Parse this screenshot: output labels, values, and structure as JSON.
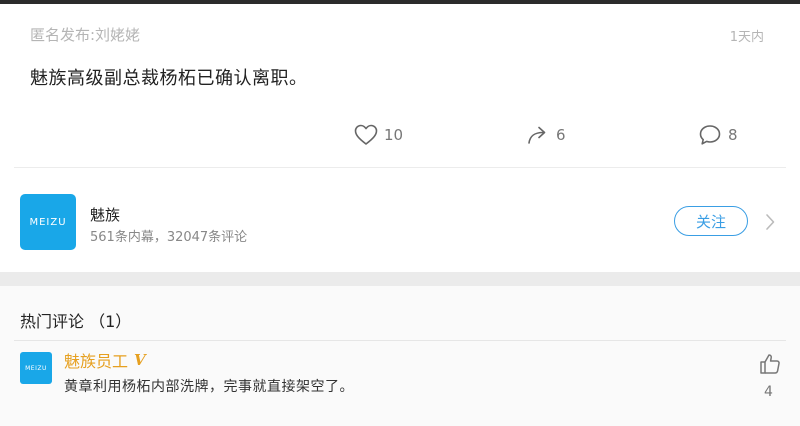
{
  "post": {
    "header": "匿名发布:刘姥姥",
    "time": "1天内",
    "text": "魅族高级副总裁杨柘已确认离职。",
    "likes": "10",
    "shares": "6",
    "comments": "8"
  },
  "account": {
    "logo_text": "MEIZU",
    "name": "魅族",
    "stats": "561条内幕，32047条评论",
    "follow_label": "关注"
  },
  "hot_comments": {
    "title": "热门评论 （1）",
    "items": [
      {
        "logo_text": "MEIZU",
        "author": "魅族员工",
        "badge": "V",
        "text": "黄章利用杨柘内部洗牌，完事就直接架空了。",
        "likes": "4"
      }
    ]
  },
  "colors": {
    "brand_blue": "#19a7e8",
    "follow_blue": "#3a9ee4",
    "author_gold": "#e6a020"
  },
  "icons": [
    "heart-icon",
    "share-arrow-icon",
    "comment-bubble-icon",
    "chevron-right-icon",
    "thumbs-up-icon"
  ]
}
